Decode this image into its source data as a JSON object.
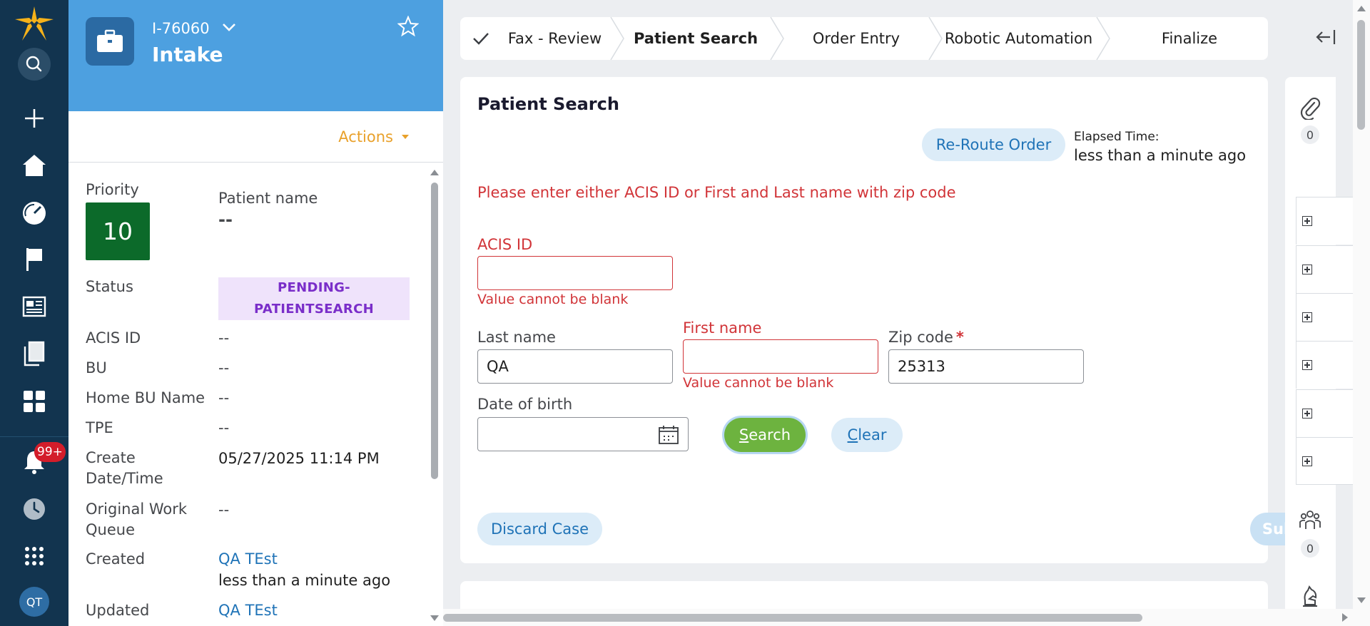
{
  "nav": {
    "items": [
      {
        "name": "logo"
      },
      {
        "name": "search"
      },
      {
        "name": "create"
      },
      {
        "name": "home"
      },
      {
        "name": "dashboard"
      },
      {
        "name": "flag"
      },
      {
        "name": "reports"
      },
      {
        "name": "documents"
      },
      {
        "name": "apps"
      }
    ],
    "notifications_badge": "99+",
    "avatar_initials": "QT"
  },
  "case": {
    "id": "I-76060",
    "title": "Intake",
    "actions_label": "Actions",
    "priority_label": "Priority",
    "priority_value": "10",
    "patient_name_label": "Patient name",
    "patient_name_value": "--",
    "status_label": "Status",
    "status_value_line1": "PENDING-",
    "status_value_line2": "PATIENTSEARCH",
    "acis_id_label": "ACIS ID",
    "acis_id_value": "--",
    "bu_label": "BU",
    "bu_value": "--",
    "home_bu_label": "Home BU Name",
    "home_bu_value": "--",
    "tpe_label": "TPE",
    "tpe_value": "--",
    "create_dt_label_line1": "Create",
    "create_dt_label_line2": "Date/Time",
    "create_dt_value": "05/27/2025 11:14 PM",
    "orig_wq_label_line1": "Original Work",
    "orig_wq_label_line2": "Queue",
    "orig_wq_value": "--",
    "created_label": "Created",
    "created_by": "QA TEst",
    "created_when": "less than a minute ago",
    "updated_label": "Updated",
    "updated_by": "QA TEst"
  },
  "stepper": {
    "steps": [
      "Fax - Review",
      "Patient Search",
      "Order Entry",
      "Robotic Automation",
      "Finalize"
    ],
    "completed": [
      0
    ],
    "active": 1
  },
  "form": {
    "title": "Patient Search",
    "reroute_label": "Re-Route Order",
    "elapsed_label": "Elapsed Time:",
    "elapsed_value": "less than a minute ago",
    "error_banner": "Please enter either ACIS ID or First and Last name with zip code",
    "acis_id_label": "ACIS ID",
    "acis_id_value": "",
    "acis_id_error": "Value cannot be blank",
    "last_name_label": "Last name",
    "last_name_value": "QA",
    "first_name_label": "First name",
    "first_name_value": "",
    "first_name_error": "Value cannot be blank",
    "zip_label": "Zip code",
    "zip_required_mark": "*",
    "zip_value": "25313",
    "dob_label": "Date of birth",
    "dob_value": "",
    "search_first": "S",
    "search_rest": "earch",
    "clear_first": "C",
    "clear_rest": "lear",
    "discard_label": "Discard Case",
    "submit_label": "Submit"
  },
  "utility": {
    "attachments_count": "0",
    "followers_count": "0"
  },
  "colors": {
    "nav_bg": "#12344f",
    "header_blue": "#4da0e0",
    "priority_green": "#0c6a2a",
    "status_purple": "#7a2ec9",
    "error_red": "#d13438",
    "search_green": "#6db33f",
    "link_blue": "#1f73b7",
    "actions_orange": "#e9a12b"
  }
}
